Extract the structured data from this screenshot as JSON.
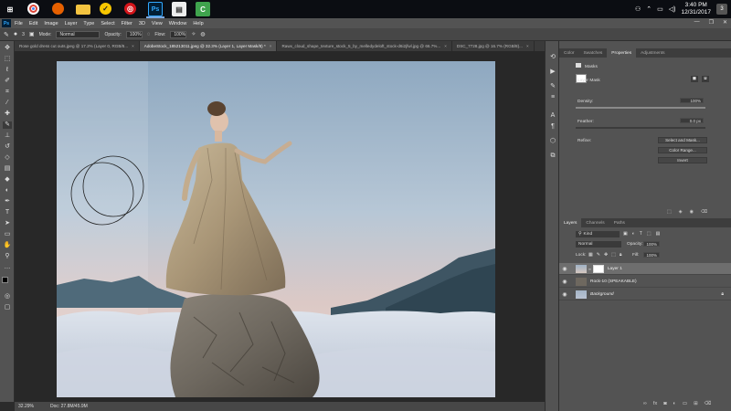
{
  "taskbar": {
    "icons": [
      "windows-logo-icon",
      "chrome-icon",
      "firefox-icon",
      "file-explorer-icon",
      "norton-icon",
      "acrobat-icon",
      "photoshop-icon",
      "notepad-icon",
      "camtasia-icon"
    ],
    "clock_time": "3:40 PM",
    "clock_date": "12/31/2017",
    "notification_count": "3"
  },
  "menubar": {
    "logo": "Ps",
    "items": [
      "File",
      "Edit",
      "Image",
      "Layer",
      "Type",
      "Select",
      "Filter",
      "3D",
      "View",
      "Window",
      "Help"
    ]
  },
  "options_bar": {
    "brush_size": "3",
    "mode_label": "Mode:",
    "mode_value": "Normal",
    "opacity_label": "Opacity:",
    "opacity_value": "100%",
    "flow_label": "Flow:",
    "flow_value": "100%"
  },
  "tabs": [
    {
      "label": "Rose gold dress cut outs.jpeg @ 17.2% (Layer 0, RGB/8...",
      "active": false
    },
    {
      "label": "AdobeStock_185213011.jpeg @ 32.3% (Layer 1, Layer Mask/8) *",
      "active": true
    },
    {
      "label": "Rawx_cloud_shape_texture_stock_5_by_melledydeloft_stock-d6i2jfwl.jpg @ 66.7%...",
      "active": false
    },
    {
      "label": "DSC_7728.jpg @ 16.7% (RGB/8)...",
      "active": false
    }
  ],
  "status": {
    "zoom": "32.29%",
    "doc": "Doc: 27.8M/45.9M"
  },
  "properties_panel": {
    "tabs": [
      "Color",
      "Swatches",
      "Properties",
      "Adjustments"
    ],
    "active_tab": "Properties",
    "header": "Masks",
    "mask_type": "Layer Mask",
    "density_label": "Density:",
    "density_value": "100%",
    "density_level": 1.0,
    "feather_label": "Feather:",
    "feather_value": "0.0 px",
    "feather_level": 0.0,
    "refine_label": "Refine:",
    "buttons": [
      "Select and Mask...",
      "Color Range...",
      "Invert"
    ]
  },
  "layers_panel": {
    "tabs": [
      "Layers",
      "Channels",
      "Paths"
    ],
    "active_tab": "Layers",
    "filter_kind": "Kind",
    "blend_mode": "Normal",
    "opacity_label": "Opacity:",
    "opacity_value": "100%",
    "lock_label": "Lock:",
    "fill_label": "Fill:",
    "fill_value": "100%",
    "layers": [
      {
        "name": "Layer 1",
        "selected": true
      },
      {
        "name": "Rock-10 (SPEAKABLE)",
        "selected": false
      },
      {
        "name": "Background",
        "selected": false
      }
    ]
  },
  "colors": {
    "ps_blue": "#31a8ff",
    "panel_bg": "#535353",
    "canvas_bg": "#282828"
  }
}
